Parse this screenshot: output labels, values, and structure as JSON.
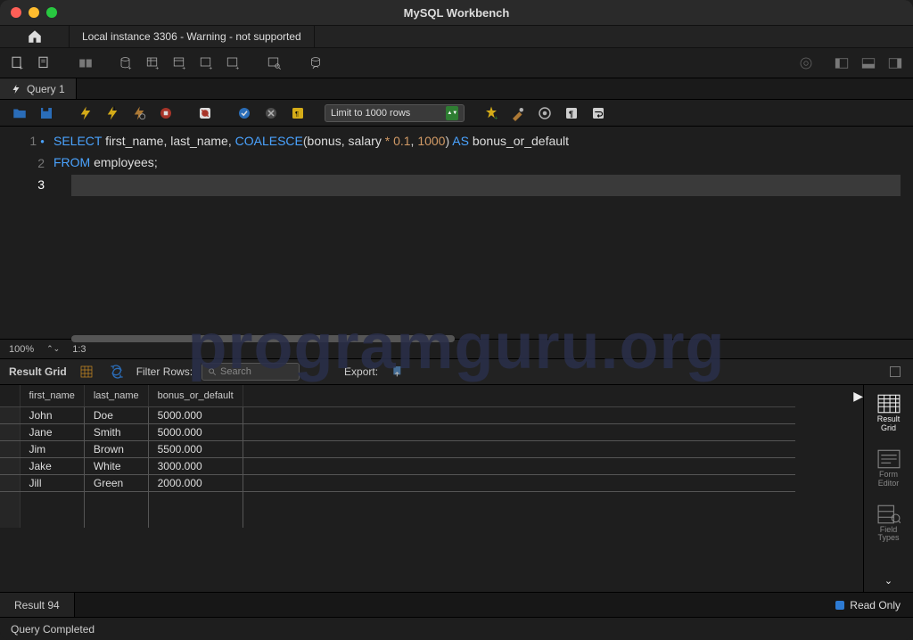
{
  "app_title": "MySQL Workbench",
  "connection_tab": "Local instance 3306 - Warning - not supported",
  "query_tab": "Query 1",
  "limit_label": "Limit to 1000 rows",
  "editor": {
    "lines": [
      "1",
      "2",
      "3"
    ],
    "code_tokens": [
      [
        {
          "t": "SELECT",
          "c": "kw"
        },
        {
          "t": " first_name",
          "c": "id"
        },
        {
          "t": ",",
          "c": "id"
        },
        {
          "t": " last_name",
          "c": "id"
        },
        {
          "t": ",",
          "c": "id"
        },
        {
          "t": " ",
          "c": "id"
        },
        {
          "t": "COALESCE",
          "c": "fn"
        },
        {
          "t": "(",
          "c": "paren"
        },
        {
          "t": "bonus",
          "c": "id"
        },
        {
          "t": ",",
          "c": "id"
        },
        {
          "t": " salary ",
          "c": "id"
        },
        {
          "t": "*",
          "c": "op"
        },
        {
          "t": " ",
          "c": "id"
        },
        {
          "t": "0.1",
          "c": "num"
        },
        {
          "t": ",",
          "c": "id"
        },
        {
          "t": " ",
          "c": "id"
        },
        {
          "t": "1000",
          "c": "num"
        },
        {
          "t": ")",
          "c": "paren"
        },
        {
          "t": " ",
          "c": "id"
        },
        {
          "t": "AS",
          "c": "kw"
        },
        {
          "t": " bonus_or_default",
          "c": "id"
        }
      ],
      [
        {
          "t": "FROM",
          "c": "kw"
        },
        {
          "t": " employees",
          "c": "id"
        },
        {
          "t": ";",
          "c": "id"
        }
      ],
      []
    ],
    "zoom": "100%",
    "cursor": "1:3"
  },
  "result_toolbar": {
    "label": "Result Grid",
    "filter_label": "Filter Rows:",
    "search_placeholder": "Search",
    "export_label": "Export:"
  },
  "columns": [
    "first_name",
    "last_name",
    "bonus_or_default"
  ],
  "rows": [
    [
      "John",
      "Doe",
      "5000.000"
    ],
    [
      "Jane",
      "Smith",
      "5000.000"
    ],
    [
      "Jim",
      "Brown",
      "5500.000"
    ],
    [
      "Jake",
      "White",
      "3000.000"
    ],
    [
      "Jill",
      "Green",
      "2000.000"
    ]
  ],
  "side_panel": {
    "result_grid": "Result\nGrid",
    "form_editor": "Form\nEditor",
    "field_types": "Field\nTypes"
  },
  "result_tab": "Result 94",
  "read_only": "Read Only",
  "footer_status": "Query Completed",
  "watermark": "programguru.org"
}
